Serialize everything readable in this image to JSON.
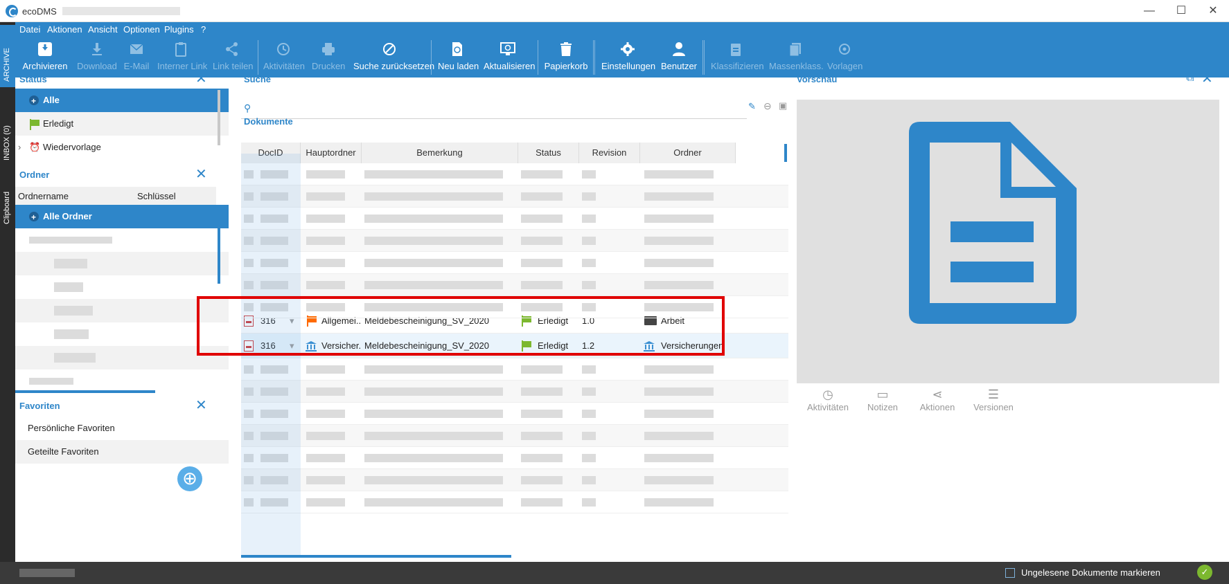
{
  "window": {
    "title": "ecoDMS",
    "minimize": "—",
    "maximize": "☐",
    "close": "✕"
  },
  "rail": {
    "archive": "ARCHIVE",
    "inbox": "INBOX (0)",
    "clipboard": "Clipboard"
  },
  "menu": [
    "Datei",
    "Aktionen",
    "Ansicht",
    "Optionen",
    "Plugins",
    "?"
  ],
  "toolbar": {
    "archivieren": "Archivieren",
    "download": "Download",
    "email": "E-Mail",
    "interner_link": "Interner Link",
    "link_teilen": "Link teilen",
    "aktivitaeten": "Aktivitäten",
    "drucken": "Drucken",
    "suche_zuruecksetzen": "Suche zurücksetzen",
    "neu_laden": "Neu laden",
    "aktualisieren": "Aktualisieren",
    "papierkorb": "Papierkorb",
    "einstellungen": "Einstellungen",
    "benutzer": "Benutzer",
    "klassifizieren": "Klassifizieren",
    "massenklass": "Massenklass.",
    "vorlagen": "Vorlagen"
  },
  "status_panel": {
    "title": "Status",
    "items": [
      "Alle",
      "Erledigt",
      "Wiedervorlage"
    ]
  },
  "ordner_panel": {
    "title": "Ordner",
    "col_name": "Ordnername",
    "col_key": "Schlüssel",
    "all": "Alle Ordner"
  },
  "favoriten_panel": {
    "title": "Favoriten",
    "items": [
      "Persönliche Favoriten",
      "Geteilte Favoriten"
    ]
  },
  "search": {
    "title": "Suche",
    "documents_title": "Dokumente"
  },
  "grid": {
    "headers": [
      "DocID",
      "Hauptordner",
      "Bemerkung",
      "Status",
      "Revision",
      "Ordner"
    ],
    "rows": [
      {
        "docid": "316",
        "hauptordner": "Allgemei...",
        "bemerkung": "Meldebescheinigung_SV_2020",
        "status": "Erledigt",
        "revision": "1.0",
        "ordner": "Arbeit"
      },
      {
        "docid": "316",
        "hauptordner": "Versicher...",
        "bemerkung": "Meldebescheinigung_SV_2020",
        "status": "Erledigt",
        "revision": "1.2",
        "ordner": "Versicherungen"
      }
    ]
  },
  "preview": {
    "title": "Vorschau",
    "actions": [
      "Aktivitäten",
      "Notizen",
      "Aktionen",
      "Versionen"
    ]
  },
  "statusbar": {
    "checkbox_label": "Ungelesene Dokumente markieren"
  },
  "colors": {
    "accent": "#2e86c9",
    "highlight_border": "#e00000",
    "flag_green": "#7cb82f",
    "flag_orange": "#ff6a00"
  }
}
